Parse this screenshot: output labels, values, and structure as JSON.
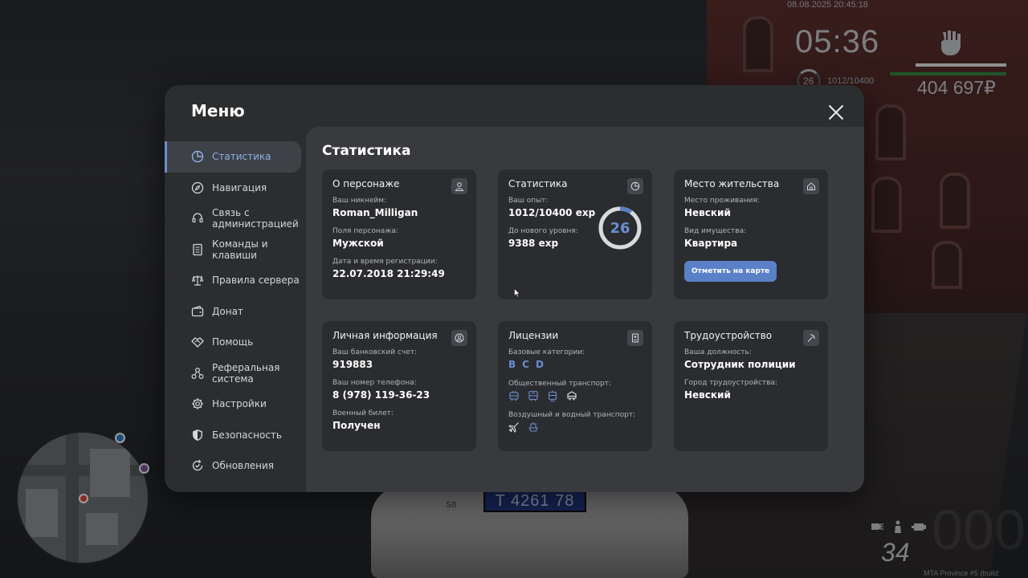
{
  "hud": {
    "datetime": "08.08.2025 20:45:18",
    "time": "05:36",
    "level": "26",
    "exp": "1012/10400",
    "money": "404 697₽",
    "speed": "34",
    "build": "MTA Province #5 (build: 6.12416.9)",
    "plate": "T 4261 78",
    "health_color": "#e8eaec",
    "armor_color": "#2f8a43"
  },
  "menu": {
    "title": "Меню",
    "close_icon": "close-icon",
    "sidebar": [
      {
        "label": "Статистика",
        "icon": "stats-icon",
        "active": true
      },
      {
        "label": "Навигация",
        "icon": "compass-icon"
      },
      {
        "label": "Связь с администрацией",
        "icon": "headset-icon"
      },
      {
        "label": "Команды и клавиши",
        "icon": "document-icon"
      },
      {
        "label": "Правила сервера",
        "icon": "scales-icon"
      },
      {
        "label": "Донат",
        "icon": "wallet-icon"
      },
      {
        "label": "Помощь",
        "icon": "handshake-icon"
      },
      {
        "label": "Реферальная система",
        "icon": "network-icon"
      },
      {
        "label": "Настройки",
        "icon": "gear-icon"
      },
      {
        "label": "Безопасность",
        "icon": "shield-icon"
      },
      {
        "label": "Обновления",
        "icon": "refresh-icon"
      }
    ],
    "accent_color": "#6a8fd1"
  },
  "content": {
    "title": "Статистика",
    "character": {
      "title": "О персонаже",
      "nickname_label": "Ваш никнейм:",
      "nickname": "Roman_Milligan",
      "gender_label": "Поля персонажа:",
      "gender": "Мужской",
      "reg_label": "Дата и время регистрации:",
      "reg": "22.07.2018 21:29:49"
    },
    "stats": {
      "title": "Статистика",
      "exp_label": "Ваш опыт:",
      "exp": "1012/10400 exp",
      "next_label": "До нового уровня:",
      "next": "9388 exp",
      "level": "26",
      "progress": 0.097
    },
    "residence": {
      "title": "Место жительства",
      "place_label": "Место проживания:",
      "place": "Невский",
      "property_label": "Вид имущества:",
      "property": "Квартира",
      "map_button": "Отметить на карте"
    },
    "personal": {
      "title": "Личная информация",
      "bank_label": "Ваш банковский счет:",
      "bank": "919883",
      "phone_label": "Ваш номер телефона:",
      "phone": "8 (978) 119-36-23",
      "military_label": "Военный билет:",
      "military": "Получен"
    },
    "licenses": {
      "title": "Лицензии",
      "base_label": "Базовые категории:",
      "categories": [
        "B",
        "C",
        "D"
      ],
      "public_label": "Общественный транспорт:",
      "public_icons": [
        "trolleybus-icon",
        "bus-icon",
        "tram-icon",
        "minibus-icon"
      ],
      "air_label": "Воздушный и водный транспорт:",
      "air_icons": [
        "airplane-icon",
        "boat-icon"
      ]
    },
    "employment": {
      "title": "Трудоустройство",
      "position_label": "Ваша должность:",
      "position": "Сотрудник полиции",
      "city_label": "Город трудоустройства:",
      "city": "Невский"
    }
  }
}
